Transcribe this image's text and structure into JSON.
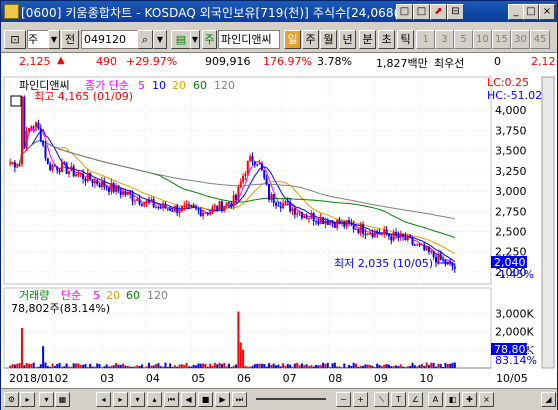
{
  "window": {
    "title": "[0600] 키움종합차트 - KOSDAQ 외국인보유[719(천)] 주식수[24,068(천",
    "buttons": [
      "□",
      "□",
      "⬈",
      "⊟",
      "×"
    ]
  },
  "toolbar": {
    "type_select": "주",
    "prev_label": "전",
    "code": "049120",
    "stock_name": "파인디앤씨",
    "tabs": [
      "일",
      "주",
      "월",
      "년",
      "분",
      "초",
      "틱"
    ],
    "active_tab": "일",
    "periods": [
      "1",
      "3",
      "5",
      "10",
      "15",
      "30",
      "45"
    ]
  },
  "pricebar": {
    "price": "2,125",
    "change": "490",
    "rate": "+29.97%",
    "volume": "909,916",
    "vol_ratio": "176.97%",
    "turnover": "3.78%",
    "amount": "1,827백만",
    "best_label": "최우선",
    "best_value": "0",
    "best_price": "2,12"
  },
  "price_panel": {
    "legend_name": "파인디앤씨",
    "legend_ma": "종가 단순",
    "ma_periods": [
      "5",
      "10",
      "20",
      "60",
      "120"
    ],
    "high_label": "최고 4,165 (01/09)",
    "low_label": "최저 2,035 (10/05)",
    "lc_label": "LC:0.25",
    "hc_label": "HC:-51.02",
    "current_price": "2,040",
    "current_rate": "-1.45%",
    "y_ticks": [
      "4,000",
      "3,750",
      "3,500",
      "3,250",
      "3,000",
      "2,750",
      "2,500",
      "2,250",
      "2,000"
    ],
    "colors": {
      "ma5": "#ff00ff",
      "ma10": "#0000ff",
      "ma20": "#e0a000",
      "ma60": "#008000",
      "ma120": "#808080",
      "up": "#ff0000",
      "down": "#0000ff"
    }
  },
  "volume_panel": {
    "legend_name": "거래량",
    "legend_ma": "단순",
    "ma_periods": [
      "5",
      "20",
      "60",
      "120"
    ],
    "max_label": "78,802주(83.14%)",
    "current_volume": "78,802",
    "current_rate": "83.14%",
    "y_ticks": [
      "3,000K",
      "2,000K",
      "1,000K"
    ]
  },
  "xaxis": {
    "labels": [
      "2018/01",
      "02",
      "03",
      "04",
      "05",
      "06",
      "07",
      "08",
      "09",
      "10",
      "10/05"
    ]
  },
  "chart_data": {
    "type": "candlestick",
    "title": "",
    "xlabel": "",
    "ylabel": "",
    "x": [
      "2018/01",
      "02",
      "03",
      "04",
      "05",
      "06",
      "07",
      "08",
      "09",
      "10"
    ],
    "close": [
      3700,
      3300,
      3050,
      2800,
      2750,
      3000,
      2700,
      2550,
      2400,
      2040
    ],
    "ylim": [
      1900,
      4250
    ],
    "volume_ylim": [
      0,
      3300
    ],
    "volume_unit": "K",
    "max": {
      "value": 4165,
      "date": "01/09"
    },
    "min": {
      "value": 2035,
      "date": "10/05"
    }
  }
}
